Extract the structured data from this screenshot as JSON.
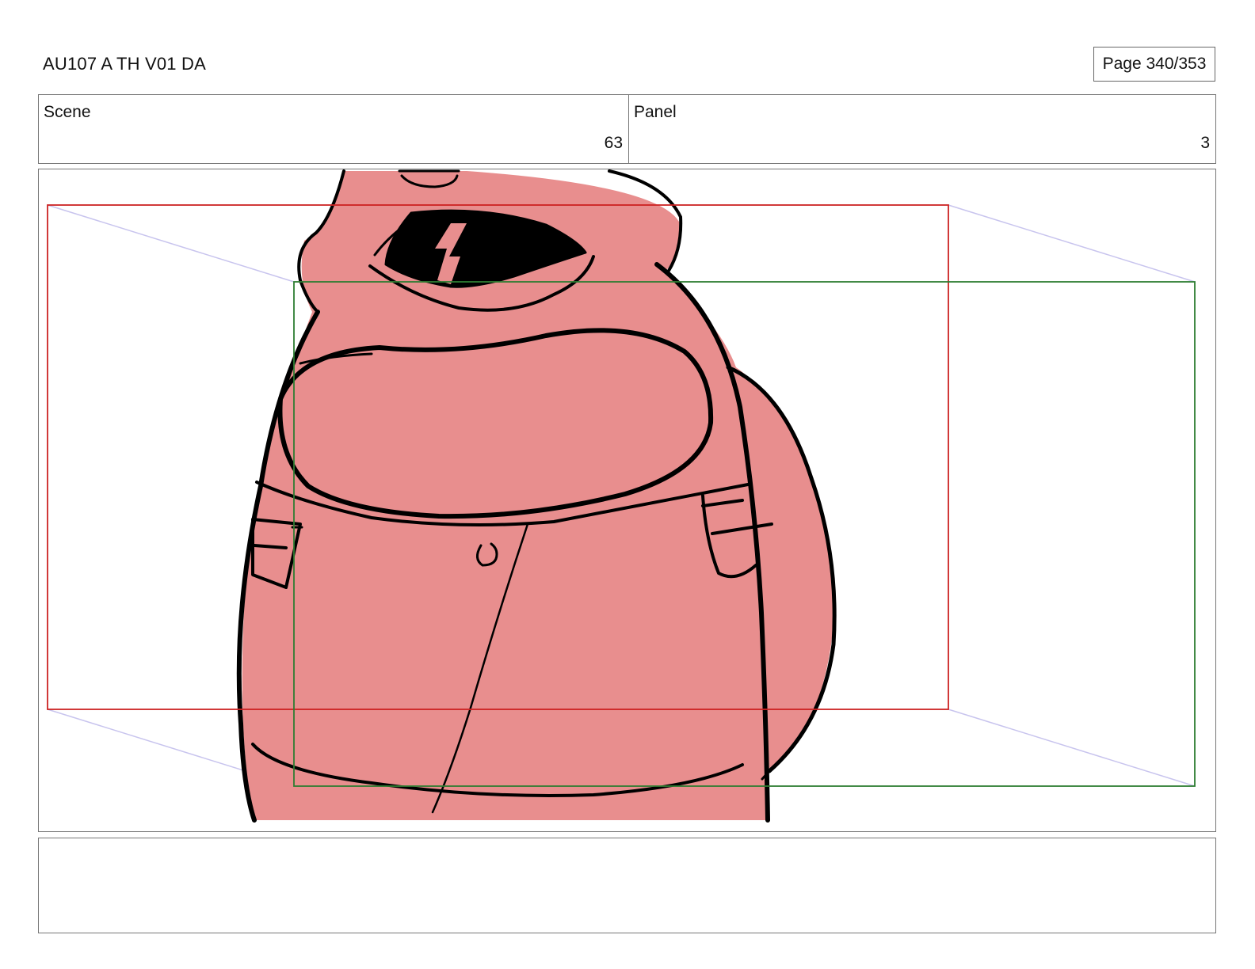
{
  "header": {
    "document_title": "AU107 A TH V01 DA",
    "page_indicator": "Page 340/353"
  },
  "info": {
    "scene_label": "Scene",
    "scene_value": "63",
    "panel_label": "Panel",
    "panel_value": "3"
  },
  "artwork": {
    "character_fill": "#e88e8e",
    "line_color": "#000000",
    "frame_start_color": "#cc2222",
    "frame_end_color": "#2e7d32",
    "camera_path_color": "#c8c4ee"
  },
  "notes": {
    "text": ""
  }
}
